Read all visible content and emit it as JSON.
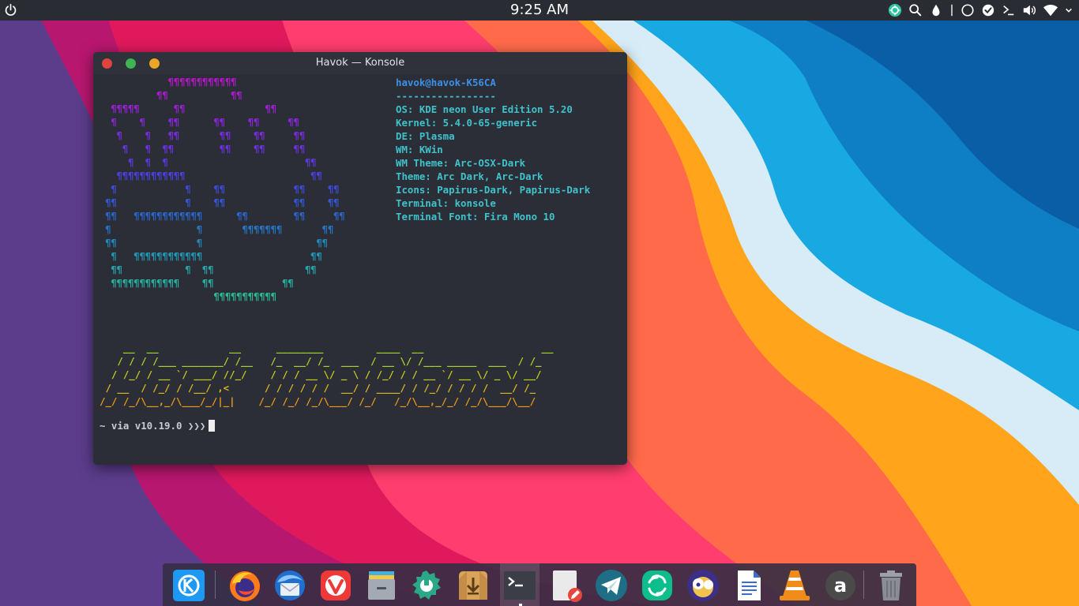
{
  "top_panel": {
    "clock": "9:25 AM",
    "power_icon": "power-icon",
    "tray_icons": [
      "vpn-icon",
      "search-icon",
      "color-picker-icon",
      "divider-icon",
      "circle-icon",
      "checkmark-icon",
      "terminal-prompt-icon",
      "volume-icon",
      "wifi-icon",
      "chevron-down-icon"
    ]
  },
  "window": {
    "title": "Havok — Konsole",
    "buttons": [
      "close",
      "minimize",
      "maximize"
    ],
    "accent_colors": {
      "close": "#e0443e",
      "minimize": "#3fb450",
      "maximize": "#e9a629"
    }
  },
  "terminal": {
    "logo_lines": [
      "            ¶¶¶¶¶¶¶¶¶¶¶¶",
      "          ¶¶           ¶¶",
      "  ¶¶¶¶¶      ¶¶              ¶¶",
      "  ¶    ¶    ¶¶      ¶¶    ¶¶     ¶¶",
      "   ¶    ¶   ¶¶       ¶¶    ¶¶     ¶¶",
      "    ¶   ¶  ¶¶        ¶¶    ¶¶     ¶¶",
      "     ¶  ¶  ¶                        ¶¶",
      "   ¶¶¶¶¶¶¶¶¶¶¶¶                      ¶¶",
      "  ¶            ¶    ¶¶            ¶¶    ¶¶",
      " ¶¶            ¶    ¶¶            ¶¶    ¶¶",
      " ¶¶   ¶¶¶¶¶¶¶¶¶¶¶¶      ¶¶        ¶¶     ¶¶",
      " ¶               ¶       ¶¶¶¶¶¶¶       ¶¶",
      " ¶¶              ¶                    ¶¶",
      "  ¶   ¶¶¶¶¶¶¶¶¶¶¶¶                   ¶¶",
      "  ¶¶           ¶  ¶¶                ¶¶",
      "  ¶¶¶¶¶¶¶¶¶¶¶¶    ¶¶            ¶¶",
      "                    ¶¶¶¶¶¶¶¶¶¶¶"
    ],
    "logo_colors": [
      "#b517c8",
      "#a91bd0",
      "#9a20d6",
      "#8a25dc",
      "#7a2be0",
      "#6b31e2",
      "#5c38e2",
      "#4d40e0",
      "#3f4adc",
      "#3457d6",
      "#2b66cf",
      "#2576c7",
      "#2287be",
      "#2396b3",
      "#25a3a9",
      "#27ae9f",
      "#2ab895"
    ],
    "info_header": "havok@havok-K56CA",
    "info_separator": "-----------------",
    "info_lines": [
      "OS: KDE neon User Edition 5.20",
      "Kernel: 5.4.0-65-generic",
      "DE: Plasma",
      "WM: KWin",
      "WM Theme: Arc-OSX-Dark",
      "Theme: Arc Dark, Arc-Dark",
      "Icons: Papirus-Dark, Papirus-Dark",
      "Terminal: konsole",
      "Terminal Font: Fira Mono 10"
    ],
    "figlet_lines": [
      "    __  __            __      ________         ____  __                    __",
      "   / / / /___ _______/ /__   /_  __/ /_  ___  / __ \\/ /___ _____  ___  / /_",
      "  / /_/ / __ `/ ___/ //_/    / / / __ \\/ _ \\ / /_/ / / __ `/ __ \\/ _ \\/ __/",
      " / __  / /_/ / /__/ ,<      / / / / / /  __/ / ____/ / /_/ / / / /  __/ /_",
      "/_/ /_/\\__,_/\\___/_/|_|    /_/ /_/ /_/\\___/ /_/   /_/\\__,_/_/ /_/\\___/\\__/"
    ],
    "prompt_text": "~ via v10.19.0 ❯❯❯"
  },
  "dock": {
    "items": [
      {
        "name": "kde-menu",
        "icon": "kde-logo-icon",
        "color": "#1d99f3"
      },
      {
        "name": "firefox",
        "icon": "firefox-icon",
        "color": "#ff7a1a"
      },
      {
        "name": "thunderbird",
        "icon": "thunderbird-icon",
        "color": "#3a8fe0"
      },
      {
        "name": "vivaldi",
        "icon": "vivaldi-icon",
        "color": "#ef3939"
      },
      {
        "name": "files",
        "icon": "file-manager-icon",
        "color": "#9aa2ad"
      },
      {
        "name": "settings",
        "icon": "system-settings-icon",
        "color": "#2aa887"
      },
      {
        "name": "installer",
        "icon": "package-installer-icon",
        "color": "#d9a35a"
      },
      {
        "name": "konsole",
        "icon": "terminal-icon",
        "color": "#3b3e46"
      },
      {
        "name": "text-editor",
        "icon": "text-editor-icon",
        "color": "#e8e8e8"
      },
      {
        "name": "telegram",
        "icon": "telegram-icon",
        "color": "#1e6f86"
      },
      {
        "name": "element",
        "icon": "element-icon",
        "color": "#0dbd8b"
      },
      {
        "name": "neochat",
        "icon": "chat-client-icon",
        "color": "#6a4bd6"
      },
      {
        "name": "writer",
        "icon": "document-icon",
        "color": "#3c6ecf"
      },
      {
        "name": "vlc",
        "icon": "vlc-icon",
        "color": "#f08c1a"
      },
      {
        "name": "amazon",
        "icon": "amazon-icon",
        "color": "#4a4a4a"
      },
      {
        "name": "trash",
        "icon": "trash-icon",
        "color": "#8a8d93"
      }
    ]
  }
}
